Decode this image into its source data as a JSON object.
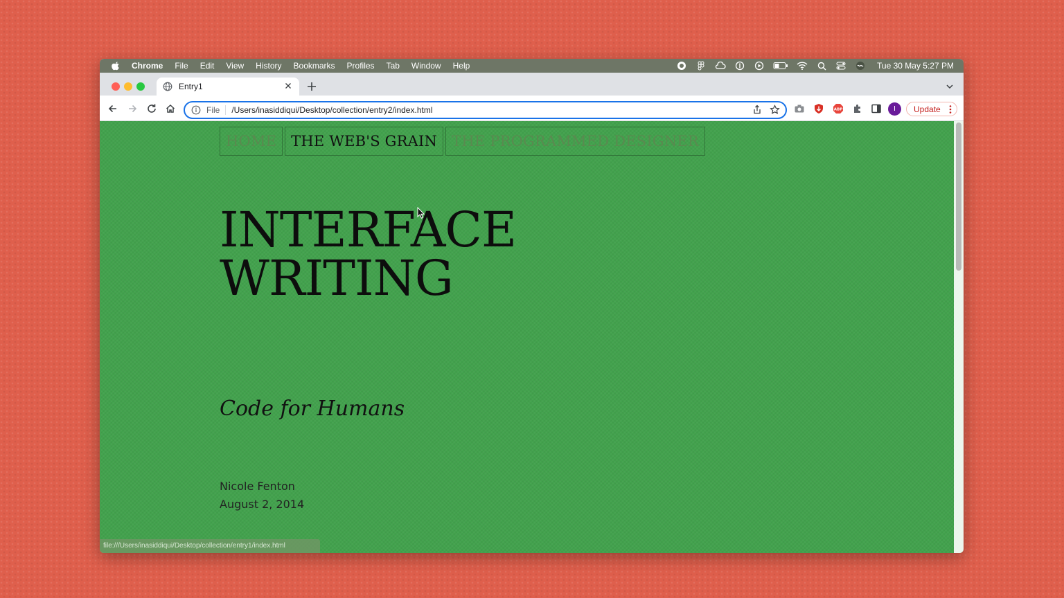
{
  "menubar": {
    "app": "Chrome",
    "items": [
      "File",
      "Edit",
      "View",
      "History",
      "Bookmarks",
      "Profiles",
      "Tab",
      "Window",
      "Help"
    ],
    "clock": "Tue 30 May  5:27 PM"
  },
  "tab": {
    "title": "Entry1"
  },
  "omnibox": {
    "scheme": "File",
    "url": "/Users/inasiddiqui/Desktop/collection/entry2/index.html"
  },
  "toolbar": {
    "update_label": "Update",
    "avatar_initial": "I"
  },
  "page": {
    "nav": [
      "HOME",
      "THE WEB'S GRAIN",
      "THE PROGRAMMED DESIGNER"
    ],
    "title_line1": "INTERFACE",
    "title_line2": "WRITING",
    "subtitle": "Code for Humans",
    "author": "Nicole Fenton",
    "date": "August 2, 2014"
  },
  "status_bar": {
    "text": "file:///Users/inasiddiqui/Desktop/collection/entry1/index.html"
  },
  "colors": {
    "background": "#df5f4c",
    "page": "#42a24d",
    "accent": "#1a73e8"
  }
}
